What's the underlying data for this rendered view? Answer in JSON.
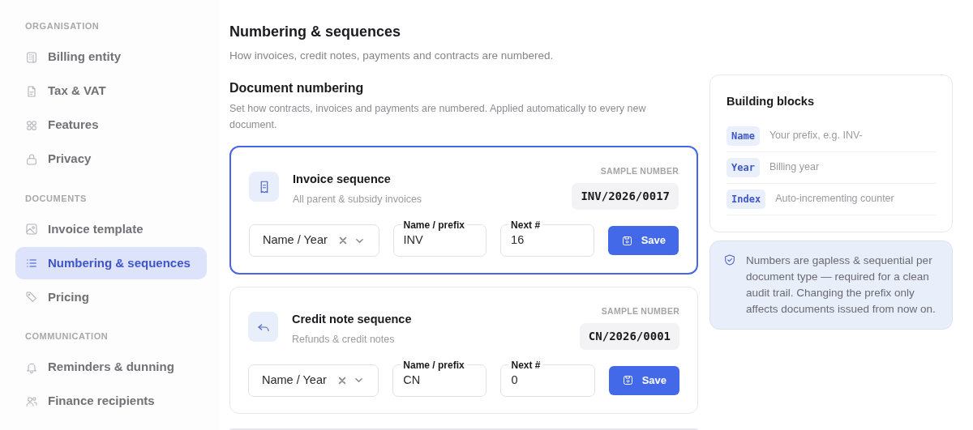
{
  "sidebar": {
    "sections": [
      {
        "heading": "ORGANISATION",
        "items": [
          {
            "label": "Billing entity",
            "selected": false
          },
          {
            "label": "Tax & VAT",
            "selected": false
          },
          {
            "label": "Features",
            "selected": false
          },
          {
            "label": "Privacy",
            "selected": false
          }
        ]
      },
      {
        "heading": "DOCUMENTS",
        "items": [
          {
            "label": "Invoice template",
            "selected": false
          },
          {
            "label": "Numbering & sequences",
            "selected": true
          },
          {
            "label": "Pricing",
            "selected": false
          }
        ]
      },
      {
        "heading": "COMMUNICATION",
        "items": [
          {
            "label": "Reminders & dunning",
            "selected": false
          },
          {
            "label": "Finance recipients",
            "selected": false
          }
        ]
      }
    ]
  },
  "page": {
    "title": "Numbering & sequences",
    "subtitle": "How invoices, credit notes, payments and contracts are numbered."
  },
  "section": {
    "title": "Document numbering",
    "description": "Set how contracts, invoices and payments are numbered. Applied automatically to every new document."
  },
  "sequences": [
    {
      "title": "Invoice sequence",
      "subtitle": "All parent & subsidy invoices",
      "sample_label": "SAMPLE NUMBER",
      "sample": "INV/2026/0017",
      "format": "Name / Year",
      "prefix_label": "Name / prefix",
      "prefix": "INV",
      "next_label": "Next #",
      "next": "16",
      "button": "Save",
      "selected": true
    },
    {
      "title": "Credit note sequence",
      "subtitle": "Refunds & credit notes",
      "sample_label": "SAMPLE NUMBER",
      "sample": "CN/2026/0001",
      "format": "Name / Year",
      "prefix_label": "Name / prefix",
      "prefix": "CN",
      "next_label": "Next #",
      "next": "0",
      "button": "Save",
      "selected": false
    }
  ],
  "building_blocks": {
    "title": "Building blocks",
    "items": [
      {
        "token": "Name",
        "description": "Your prefix, e.g. INV-"
      },
      {
        "token": "Year",
        "description": "Billing year"
      },
      {
        "token": "Index",
        "description": "Auto-incrementing counter"
      }
    ]
  },
  "note": "Numbers are gapless & sequential per document type — required for a clean audit trail. Changing the prefix only affects documents issued from now on."
}
